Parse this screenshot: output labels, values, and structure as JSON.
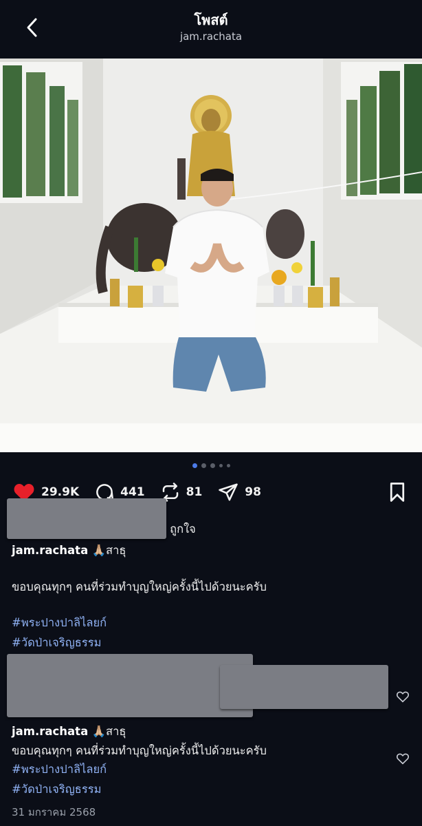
{
  "header": {
    "title": "โพสต์",
    "username": "jam.rachata"
  },
  "carousel": {
    "total": 5,
    "active": 0
  },
  "actions": {
    "likes": "29.9K",
    "comments": "441",
    "reposts": "81",
    "shares": "98"
  },
  "likes_line": {
    "suffix": "ๆ ถูกใจ"
  },
  "caption": {
    "username": "jam.rachata",
    "emoji": "🙏🏼",
    "word": "สาธุ",
    "body": "ขอบคุณทุกๆ คนที่ร่วมทำบุญใหญ่ครั้งนี้ไปด้วยนะครับ",
    "hashtags": [
      "#พระปางปาลิไลยก์",
      "#วัดป่าเจริญธรรม"
    ]
  },
  "comment": {
    "username": "jam.rachata",
    "emoji": "🙏🏼",
    "word": "สาธุ",
    "body": "ขอบคุณทุกๆ คนที่ร่วมทำบุญใหญ่ครั้งนี้ไปด้วยนะครับ",
    "hashtags": [
      "#พระปางปาลิไลยก์",
      "#วัดป่าเจริญธรรม"
    ]
  },
  "date": "31 มกราคม 2568",
  "colors": {
    "like_red": "#e8202a",
    "hashtag_blue": "#8fb1f3",
    "background": "#0b0e17"
  }
}
